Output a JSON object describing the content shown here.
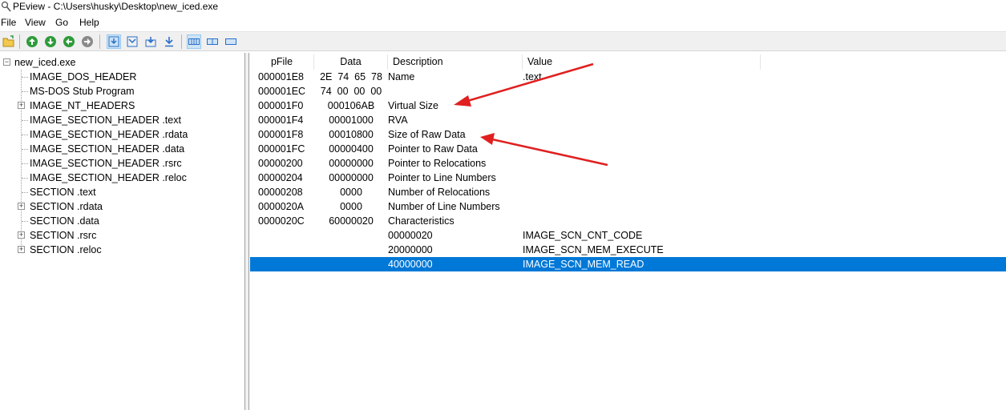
{
  "window": {
    "title": "PEview - C:\\Users\\husky\\Desktop\\new_iced.exe"
  },
  "menu": {
    "file": "File",
    "view": "View",
    "go": "Go",
    "help": "Help"
  },
  "toolbar": {
    "buttons": [
      {
        "icon": "open-folder-icon"
      },
      {
        "icon": "arrow-up-icon"
      },
      {
        "icon": "arrow-down-icon"
      },
      {
        "icon": "arrow-back-icon"
      },
      {
        "icon": "arrow-forward-icon"
      },
      {
        "icon": "view-hex-icon"
      },
      {
        "icon": "view-down-icon"
      },
      {
        "icon": "view-right-icon"
      },
      {
        "icon": "view-details-icon"
      },
      {
        "icon": "view-byte-icon"
      },
      {
        "icon": "view-word-icon"
      },
      {
        "icon": "view-dword-icon"
      }
    ],
    "colors": {
      "green": "#2e9b3a",
      "blue": "#2a6fc9",
      "gray": "#8a8a8a"
    }
  },
  "tree": {
    "root": "new_iced.exe",
    "items": [
      {
        "label": "IMAGE_DOS_HEADER",
        "expandable": false
      },
      {
        "label": "MS-DOS Stub Program",
        "expandable": false
      },
      {
        "label": "IMAGE_NT_HEADERS",
        "expandable": true
      },
      {
        "label": "IMAGE_SECTION_HEADER .text",
        "expandable": false
      },
      {
        "label": "IMAGE_SECTION_HEADER .rdata",
        "expandable": false
      },
      {
        "label": "IMAGE_SECTION_HEADER .data",
        "expandable": false
      },
      {
        "label": "IMAGE_SECTION_HEADER .rsrc",
        "expandable": false
      },
      {
        "label": "IMAGE_SECTION_HEADER .reloc",
        "expandable": false
      },
      {
        "label": "SECTION .text",
        "expandable": false
      },
      {
        "label": "SECTION .rdata",
        "expandable": true
      },
      {
        "label": "SECTION .data",
        "expandable": false
      },
      {
        "label": "SECTION .rsrc",
        "expandable": true
      },
      {
        "label": "SECTION .reloc",
        "expandable": true
      }
    ]
  },
  "table": {
    "columns": [
      "pFile",
      "Data",
      "Description",
      "Value"
    ],
    "rows": [
      {
        "pfile": "000001E8",
        "data": "2E  74  65  78",
        "desc": "Name",
        "value": ".text"
      },
      {
        "pfile": "000001EC",
        "data": "74  00  00  00",
        "desc": "",
        "value": ""
      },
      {
        "pfile": "000001F0",
        "data": "000106AB",
        "desc": "Virtual Size",
        "value": ""
      },
      {
        "pfile": "000001F4",
        "data": "00001000",
        "desc": "RVA",
        "value": ""
      },
      {
        "pfile": "000001F8",
        "data": "00010800",
        "desc": "Size of Raw Data",
        "value": ""
      },
      {
        "pfile": "000001FC",
        "data": "00000400",
        "desc": "Pointer to Raw Data",
        "value": ""
      },
      {
        "pfile": "00000200",
        "data": "00000000",
        "desc": "Pointer to Relocations",
        "value": ""
      },
      {
        "pfile": "00000204",
        "data": "00000000",
        "desc": "Pointer to Line Numbers",
        "value": ""
      },
      {
        "pfile": "00000208",
        "data": "0000",
        "desc": "Number of Relocations",
        "value": ""
      },
      {
        "pfile": "0000020A",
        "data": "0000",
        "desc": "Number of Line Numbers",
        "value": ""
      },
      {
        "pfile": "0000020C",
        "data": "60000020",
        "desc": "Characteristics",
        "value": ""
      },
      {
        "pfile": "",
        "data": "",
        "desc": "00000020",
        "value": "IMAGE_SCN_CNT_CODE"
      },
      {
        "pfile": "",
        "data": "",
        "desc": "20000000",
        "value": "IMAGE_SCN_MEM_EXECUTE"
      },
      {
        "pfile": "",
        "data": "",
        "desc": "40000000",
        "value": "IMAGE_SCN_MEM_READ",
        "selected": true
      }
    ]
  },
  "colors": {
    "selection": "#0078d7",
    "annotation_arrow": "#e02020"
  }
}
